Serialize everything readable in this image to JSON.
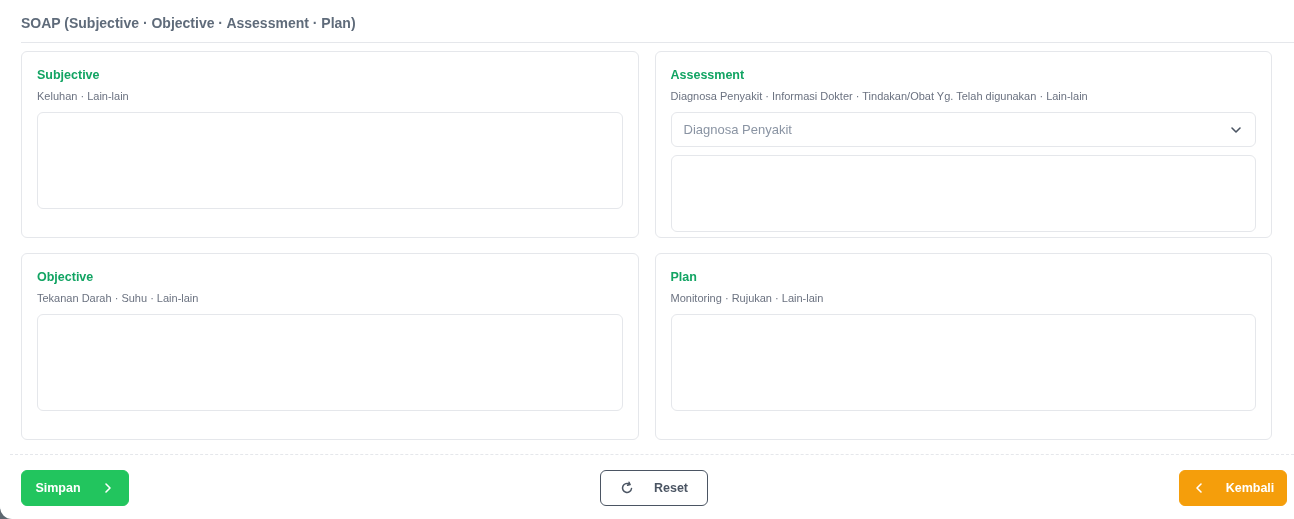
{
  "title": "SOAP (Subjective · Objective · Assessment · Plan)",
  "sections": [
    {
      "title": "Subjective",
      "hint": "Keluhan · Lain-lain",
      "kind": "text"
    },
    {
      "title": "Assessment",
      "hint": "Diagnosa Penyakit · Informasi Dokter · Tindakan/Obat Yg. Telah digunakan · Lain-lain",
      "kind": "select_text",
      "select": {
        "placeholder": "Diagnosa Penyakit"
      }
    },
    {
      "title": "Objective",
      "hint": "Tekanan Darah · Suhu · Lain-lain",
      "kind": "text"
    },
    {
      "title": "Plan",
      "hint": "Monitoring · Rujukan · Lain-lain",
      "kind": "text"
    }
  ],
  "buttons": [
    {
      "label": "Simpan",
      "kind": "primary"
    },
    {
      "label": "Reset",
      "kind": "outline"
    },
    {
      "label": "Kembali",
      "kind": "warning"
    }
  ]
}
